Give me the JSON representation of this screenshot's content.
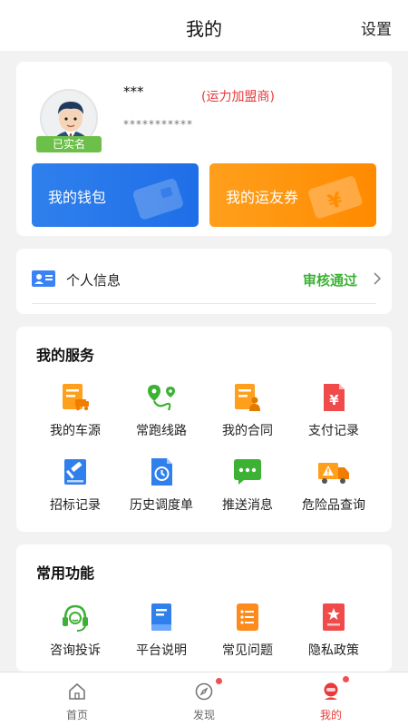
{
  "header": {
    "title": "我的",
    "settings": "设置"
  },
  "profile": {
    "name": "***",
    "role": "(运力加盟商)",
    "phone": "***********",
    "verified_badge": "已实名",
    "wallet_label": "我的钱包",
    "coupon_label": "我的运友券"
  },
  "personal_info": {
    "label": "个人信息",
    "status": "审核通过"
  },
  "services": {
    "title": "我的服务",
    "items": [
      {
        "label": "我的车源",
        "icon": "vehicle-source-icon"
      },
      {
        "label": "常跑线路",
        "icon": "route-icon"
      },
      {
        "label": "我的合同",
        "icon": "contract-icon"
      },
      {
        "label": "支付记录",
        "icon": "payment-record-icon"
      },
      {
        "label": "招标记录",
        "icon": "bidding-icon"
      },
      {
        "label": "历史调度单",
        "icon": "dispatch-history-icon"
      },
      {
        "label": "推送消息",
        "icon": "message-icon"
      },
      {
        "label": "危险品查询",
        "icon": "hazard-truck-icon"
      }
    ]
  },
  "common": {
    "title": "常用功能",
    "items": [
      {
        "label": "咨询投诉",
        "icon": "support-headset-icon"
      },
      {
        "label": "平台说明",
        "icon": "book-icon"
      },
      {
        "label": "常见问题",
        "icon": "faq-list-icon"
      },
      {
        "label": "隐私政策",
        "icon": "privacy-icon"
      }
    ]
  },
  "tabbar": {
    "items": [
      {
        "label": "首页",
        "icon": "home-icon",
        "active": false
      },
      {
        "label": "发现",
        "icon": "compass-icon",
        "active": false
      },
      {
        "label": "我的",
        "icon": "profile-icon",
        "active": true
      }
    ]
  },
  "colors": {
    "accent_red": "#e83a3a",
    "wallet_blue": "#2f80ed",
    "coupon_orange": "#ff9f1c",
    "success_green": "#3cb134"
  }
}
